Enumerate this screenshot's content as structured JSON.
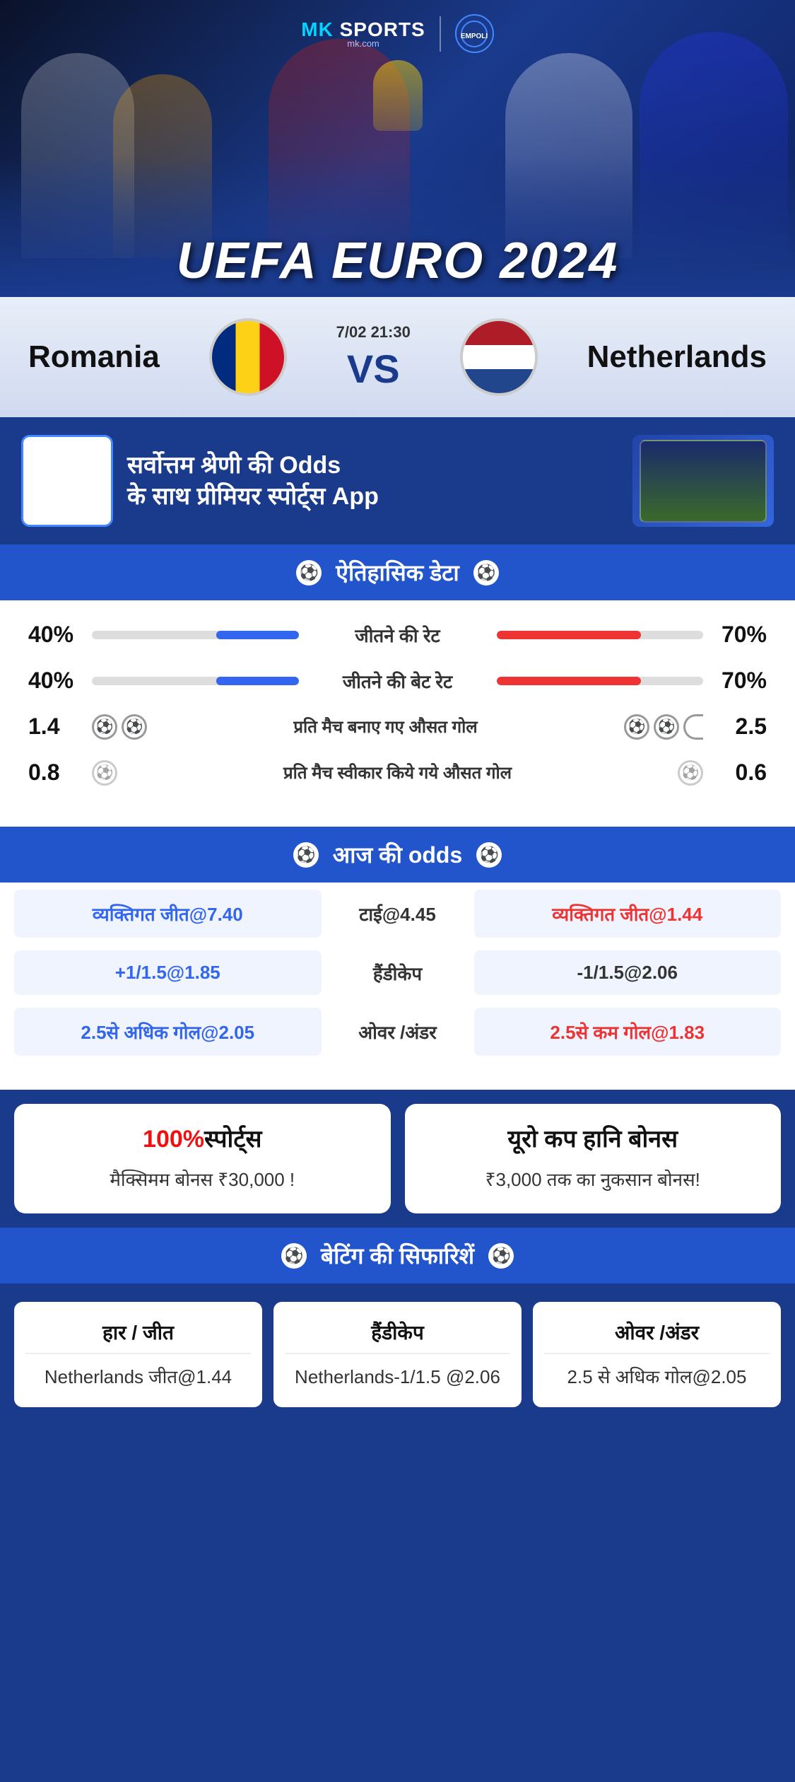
{
  "brand": {
    "name": "MK SPORTS",
    "sub": "mk.com",
    "divider": "|"
  },
  "event": {
    "title": "UEFA EURO 2024",
    "date": "7/02 21:30",
    "vs": "VS",
    "team_left": "Romania",
    "team_right": "Netherlands"
  },
  "app_promo": {
    "text_line1": "सर्वोत्तम श्रेणी की",
    "text_bold": "Odds",
    "text_line2": "के साथ प्रीमियर स्पोर्ट्स",
    "text_bold2": "App"
  },
  "historical": {
    "header": "ऐतिहासिक डेटा",
    "rows": [
      {
        "label": "जीतने की रेट",
        "left_val": "40%",
        "right_val": "70%",
        "left_pct": 40,
        "right_pct": 70
      },
      {
        "label": "जीतने की बेट रेट",
        "left_val": "40%",
        "right_val": "70%",
        "left_pct": 40,
        "right_pct": 70
      }
    ],
    "goal_rows": [
      {
        "label": "प्रति मैच बनाए गए औसत गोल",
        "left_val": "1.4",
        "right_val": "2.5",
        "left_icons": 2,
        "right_icons": 3
      },
      {
        "label": "प्रति मैच स्वीकार किये गये औसत गोल",
        "left_val": "0.8",
        "right_val": "0.6",
        "left_icons": 1,
        "right_icons": 1
      }
    ]
  },
  "odds": {
    "header": "आज की odds",
    "rows": [
      {
        "left": "व्यक्तिगत जीत@7.40",
        "center": "टाई@4.45",
        "right": "व्यक्तिगत जीत@1.44"
      },
      {
        "left": "+1/1.5@1.85",
        "center": "हैंडीकेप",
        "right": "-1/1.5@2.06"
      },
      {
        "left": "2.5से अधिक गोल@2.05",
        "center": "ओवर /अंडर",
        "right": "2.5से कम गोल@1.83"
      }
    ]
  },
  "bonus": {
    "card1": {
      "title_red": "100%",
      "title_black": "स्पोर्ट्स",
      "desc": "मैक्सिमम बोनस  ₹30,000 !"
    },
    "card2": {
      "title": "यूरो कप हानि बोनस",
      "desc": "₹3,000 तक का नुकसान बोनस!"
    }
  },
  "recommendations": {
    "header": "बेटिंग की सिफारिशें",
    "items": [
      {
        "title": "हार / जीत",
        "value": "Netherlands जीत@1.44"
      },
      {
        "title": "हैंडीकेप",
        "value": "Netherlands-1/1.5 @2.06"
      },
      {
        "title": "ओवर /अंडर",
        "value": "2.5 से अधिक गोल@2.05"
      }
    ]
  }
}
